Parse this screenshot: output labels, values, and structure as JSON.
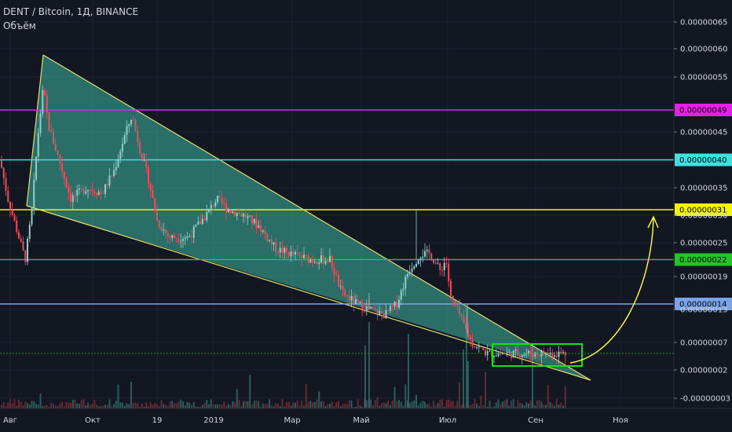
{
  "header": {
    "symbol_line": "DENT / Bitcoin, 1Д, BINANCE",
    "volume_label": "Объём"
  },
  "chart_data": {
    "type": "candlestick",
    "y_ticks": [
      "0.00000065",
      "0.00000060",
      "0.00000055",
      "0.00000045",
      "0.00000035",
      "0.00000030",
      "0.00000025",
      "0.00000019",
      "0.00000013",
      "0.00000007",
      "0.00000002",
      "-0.00000003"
    ],
    "y_tick_values": [
      65,
      60,
      55,
      45,
      35,
      30,
      25,
      19,
      13,
      7,
      2,
      -3
    ],
    "x_ticks": [
      "Авг",
      "Окт",
      "19",
      "2019",
      "Мар",
      "Май",
      "Июл",
      "Сен",
      "Ноя"
    ],
    "levels": [
      {
        "label": "0.00000049",
        "value": 49,
        "color": "#e91ee6",
        "text_color": "#000000"
      },
      {
        "label": "0.00000040",
        "value": 40,
        "color": "#40e0e0",
        "text_color": "#000000"
      },
      {
        "label": "0.00000031",
        "value": 31,
        "color": "#f5f500",
        "text_color": "#000000"
      },
      {
        "label": "0.00000022",
        "value": 22,
        "color": "#22c528",
        "text_color": "#000000"
      },
      {
        "label": "0.00000014",
        "value": 14,
        "color": "#7aa4e8",
        "text_color": "#000000"
      }
    ],
    "triangle_color": "#3fb5a0",
    "triangle_line": "#e0e070",
    "box_color": "#18e018",
    "arrow_color": "#ffff40",
    "up_color": "#8fd0cc",
    "down_color": "#ef4d5c"
  }
}
